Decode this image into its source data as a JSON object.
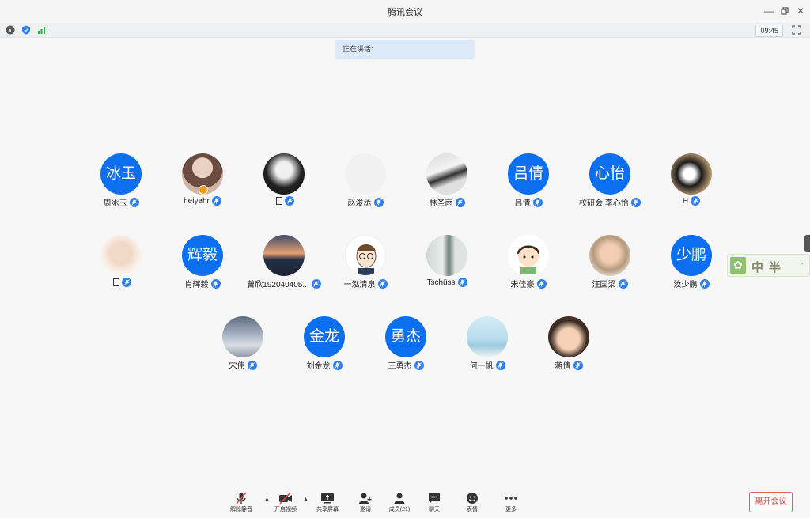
{
  "window": {
    "title": "腾讯会议"
  },
  "status": {
    "time": "09:45"
  },
  "speaking": {
    "label": "正在讲话:"
  },
  "participants": [
    {
      "name": "周冰玉",
      "avatar_text": "冰玉"
    },
    {
      "name": "heiyahr",
      "avatar_text": ""
    },
    {
      "name": "",
      "avatar_text": ""
    },
    {
      "name": "赵浚丞",
      "avatar_text": ""
    },
    {
      "name": "林圣雨",
      "avatar_text": ""
    },
    {
      "name": "吕倩",
      "avatar_text": "吕倩"
    },
    {
      "name": "校研会 李心怡",
      "avatar_text": "心怡"
    },
    {
      "name": "H",
      "avatar_text": ""
    },
    {
      "name": "",
      "avatar_text": ""
    },
    {
      "name": "肖辉毅",
      "avatar_text": "辉毅"
    },
    {
      "name": "曾欣192040405...",
      "avatar_text": ""
    },
    {
      "name": "一泓清泉",
      "avatar_text": ""
    },
    {
      "name": "Tschüss",
      "avatar_text": ""
    },
    {
      "name": "宋佳豪",
      "avatar_text": ""
    },
    {
      "name": "汪国梁",
      "avatar_text": ""
    },
    {
      "name": "汝少鹏",
      "avatar_text": "少鹏"
    },
    {
      "name": "宋伟",
      "avatar_text": ""
    },
    {
      "name": "刘金龙",
      "avatar_text": "金龙"
    },
    {
      "name": "王勇杰",
      "avatar_text": "勇杰"
    },
    {
      "name": "何一帆",
      "avatar_text": ""
    },
    {
      "name": "蒋倩",
      "avatar_text": ""
    }
  ],
  "toolbar": {
    "unmute": "解除静音",
    "start_video": "开启视频",
    "share_screen": "共享屏幕",
    "invite": "邀请",
    "members": "成员(21)",
    "chat": "聊天",
    "reactions": "表情",
    "more": "更多",
    "leave": "离开会议"
  },
  "widget": {
    "text": "中半",
    "dots": "°,"
  },
  "colors": {
    "accent": "#0b6ff0",
    "mic": "#2f7ef2",
    "leave": "#d9423a"
  }
}
